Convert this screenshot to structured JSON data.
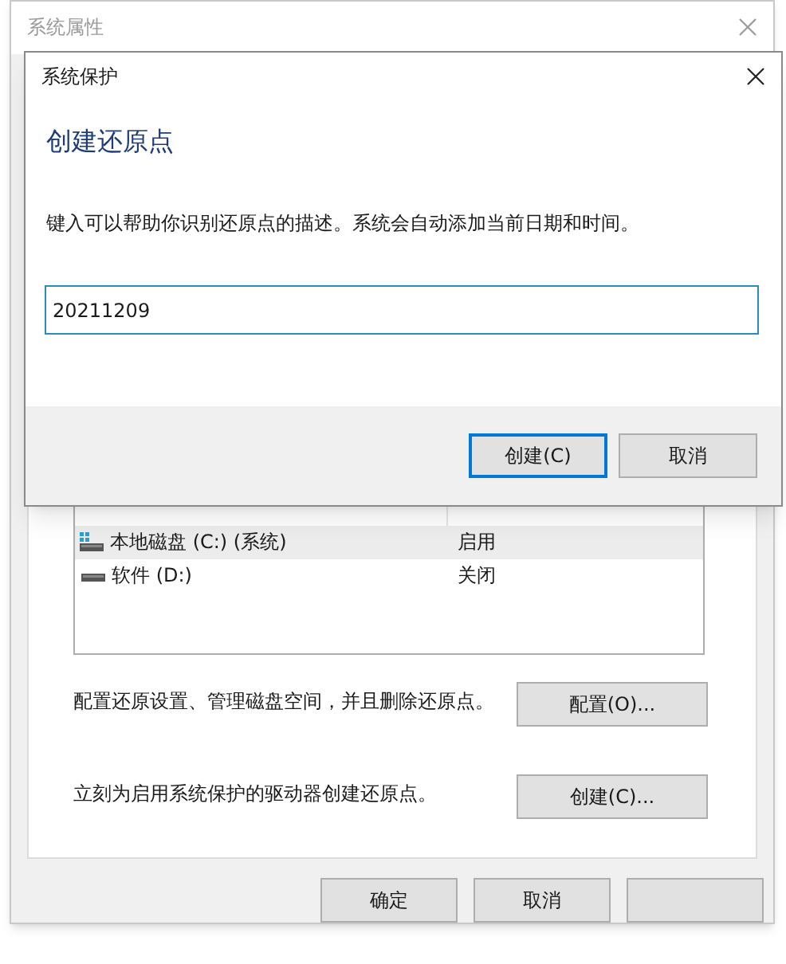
{
  "background_window": {
    "title": "系统属性",
    "drives": {
      "rows": [
        {
          "name": "本地磁盘 (C:) (系统)",
          "protection": "启用",
          "kind": "system",
          "selected": true
        },
        {
          "name": "软件 (D:)",
          "protection": "关闭",
          "kind": "data",
          "selected": false
        }
      ]
    },
    "actions": [
      {
        "text": "配置还原设置、管理磁盘空间，并且删除还原点。",
        "button": "配置(O)..."
      },
      {
        "text": "立刻为启用系统保护的驱动器创建还原点。",
        "button": "创建(C)..."
      }
    ],
    "buttons": [
      {
        "label": "确定"
      },
      {
        "label": "取消"
      }
    ]
  },
  "dialog": {
    "title": "系统保护",
    "heading": "创建还原点",
    "description": "键入可以帮助你识别还原点的描述。系统会自动添加当前日期和时间。",
    "input": {
      "value": "20211209"
    },
    "buttons": [
      {
        "label": "创建(C)",
        "default": true
      },
      {
        "label": "取消",
        "default": false
      }
    ]
  }
}
